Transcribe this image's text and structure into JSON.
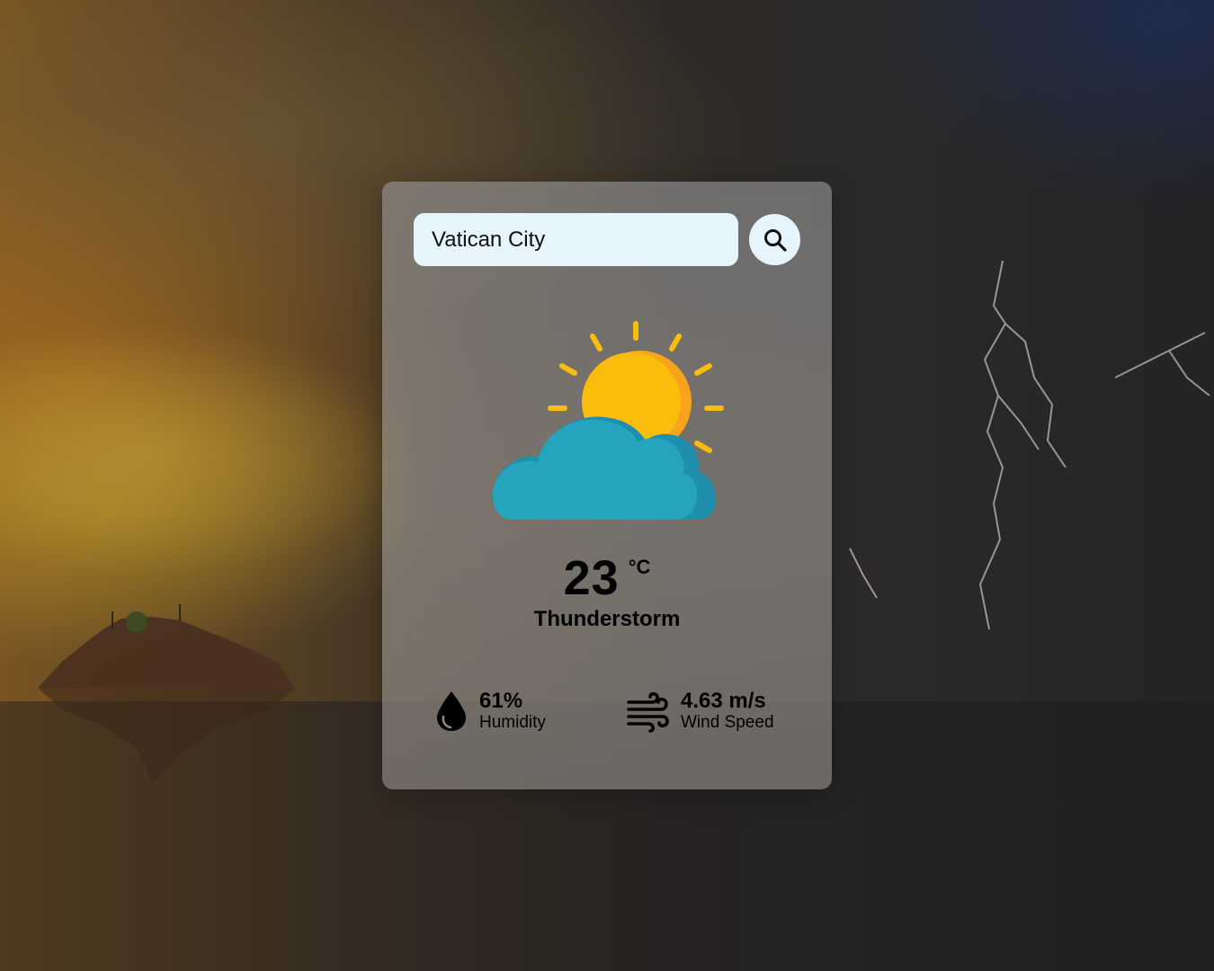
{
  "search": {
    "value": "Vatican City",
    "button_icon": "search-icon"
  },
  "weather": {
    "icon": "partly-cloudy-icon",
    "temperature": "23",
    "unit": "°C",
    "condition": "Thunderstorm"
  },
  "details": {
    "humidity": {
      "icon": "water-drop-icon",
      "value": "61%",
      "label": "Humidity"
    },
    "wind": {
      "icon": "wind-icon",
      "value": "4.63 m/s",
      "label": "Wind Speed"
    }
  },
  "colors": {
    "card_bg": "rgba(150,150,150,0.62)",
    "input_bg": "#e6f4fb",
    "sun": "#fbbd0c",
    "sun_shade": "#f7a31c",
    "cloud": "#26a3bd",
    "cloud_shade": "#1e8fae"
  }
}
